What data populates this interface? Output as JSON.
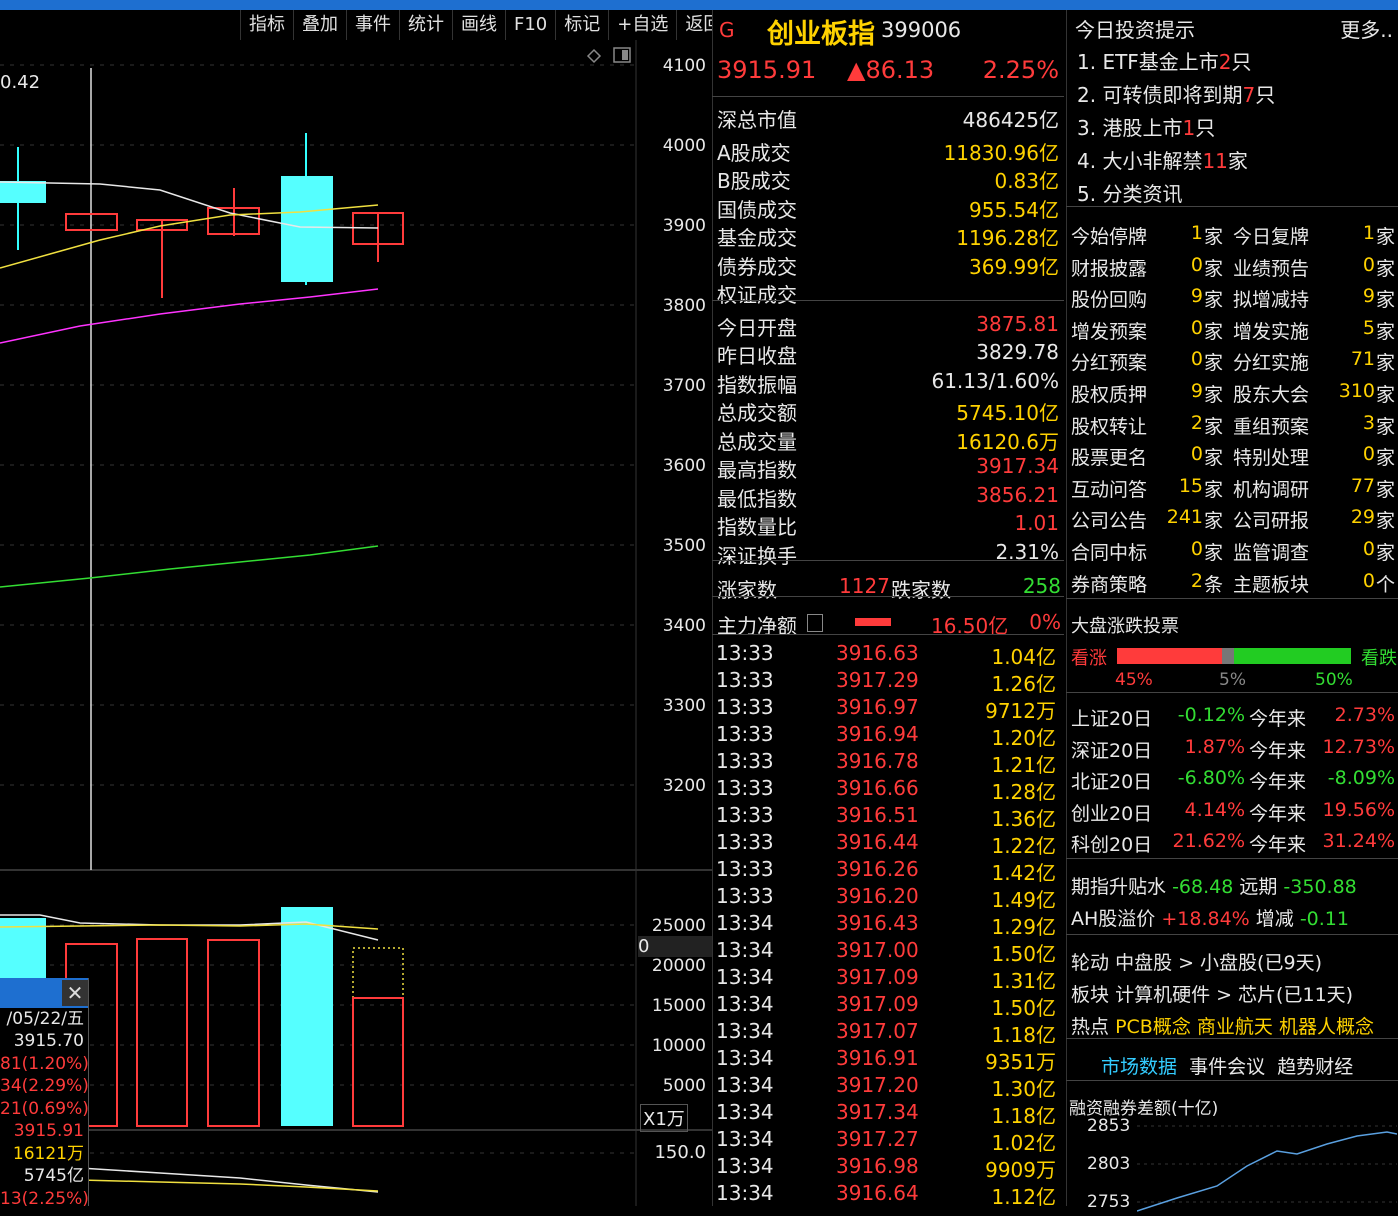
{
  "toolbar": [
    "指标",
    "叠加",
    "事件",
    "统计",
    "画线",
    "F10",
    "标记",
    "+自选",
    "返回"
  ],
  "chart": {
    "top_value": "0.42",
    "y_ticks": [
      "4100",
      "4000",
      "3900",
      "3800",
      "3700",
      "3600",
      "3500",
      "3400",
      "3300",
      "3200"
    ],
    "vol_ticks": [
      "25000",
      "20000",
      "15000",
      "10000",
      "5000"
    ],
    "vol_unit": "X1万",
    "vol_marker": "0",
    "macd_tick": "150.0"
  },
  "popup": {
    "date": "/05/22/五",
    "values": [
      "3915.70",
      "81(1.20%)",
      "34(2.29%)",
      "21(0.69%)",
      "3915.91",
      "16121万",
      "5745亿",
      "13(2.25%)"
    ]
  },
  "header": {
    "flag": "G",
    "name": "创业板指",
    "code": "399006",
    "price": "3915.91",
    "change": "▲86.13",
    "pct": "2.25%"
  },
  "stats": [
    {
      "k": "深总市值",
      "v": "486425亿",
      "c": "white"
    },
    {
      "k": "A股成交",
      "v": "11830.96亿",
      "c": "yellow"
    },
    {
      "k": "B股成交",
      "v": "0.83亿",
      "c": "yellow"
    },
    {
      "k": "国债成交",
      "v": "955.54亿",
      "c": "yellow"
    },
    {
      "k": "基金成交",
      "v": "1196.28亿",
      "c": "yellow"
    },
    {
      "k": "债券成交",
      "v": "369.99亿",
      "c": "yellow"
    },
    {
      "k": "权证成交",
      "v": "",
      "c": "yellow"
    },
    {
      "k": "今日开盘",
      "v": "3875.81",
      "c": "red"
    },
    {
      "k": "昨日收盘",
      "v": "3829.78",
      "c": "white"
    },
    {
      "k": "指数振幅",
      "v": "61.13/1.60%",
      "c": "white"
    },
    {
      "k": "总成交额",
      "v": "5745.10亿",
      "c": "yellow"
    },
    {
      "k": "总成交量",
      "v": "16120.6万",
      "c": "yellow"
    },
    {
      "k": "最高指数",
      "v": "3917.34",
      "c": "red"
    },
    {
      "k": "最低指数",
      "v": "3856.21",
      "c": "red"
    },
    {
      "k": "指数量比",
      "v": "1.01",
      "c": "red"
    },
    {
      "k": "深证换手",
      "v": "2.31%",
      "c": "white"
    }
  ],
  "updown": {
    "up_label": "涨家数",
    "up": "1127",
    "down_label": "跌家数",
    "down": "258"
  },
  "netflow": {
    "label": "主力净额",
    "value": "16.50亿",
    "pct": "0%"
  },
  "ticks": [
    [
      "13:33",
      "3916.63",
      "1.04亿"
    ],
    [
      "13:33",
      "3917.29",
      "1.26亿"
    ],
    [
      "13:33",
      "3916.97",
      "9712万"
    ],
    [
      "13:33",
      "3916.94",
      "1.20亿"
    ],
    [
      "13:33",
      "3916.78",
      "1.21亿"
    ],
    [
      "13:33",
      "3916.66",
      "1.28亿"
    ],
    [
      "13:33",
      "3916.51",
      "1.36亿"
    ],
    [
      "13:33",
      "3916.44",
      "1.22亿"
    ],
    [
      "13:33",
      "3916.26",
      "1.42亿"
    ],
    [
      "13:33",
      "3916.20",
      "1.49亿"
    ],
    [
      "13:34",
      "3916.43",
      "1.29亿"
    ],
    [
      "13:34",
      "3917.00",
      "1.50亿"
    ],
    [
      "13:34",
      "3917.09",
      "1.31亿"
    ],
    [
      "13:34",
      "3917.09",
      "1.50亿"
    ],
    [
      "13:34",
      "3917.07",
      "1.18亿"
    ],
    [
      "13:34",
      "3916.91",
      "9351万"
    ],
    [
      "13:34",
      "3917.20",
      "1.30亿"
    ],
    [
      "13:34",
      "3917.34",
      "1.18亿"
    ],
    [
      "13:34",
      "3917.27",
      "1.02亿"
    ],
    [
      "13:34",
      "3916.98",
      "9909万"
    ],
    [
      "13:34",
      "3916.64",
      "1.12亿"
    ]
  ],
  "tips": {
    "title": "今日投资提示",
    "more": "更多..",
    "items": [
      {
        "pre": "1. ETF基金上市",
        "num": "2",
        "post": "只"
      },
      {
        "pre": "2. 可转债即将到期",
        "num": "7",
        "post": "只"
      },
      {
        "pre": "3. 港股上市",
        "num": "1",
        "post": "只"
      },
      {
        "pre": "4. 大小非解禁",
        "num": "11",
        "post": "家"
      },
      {
        "pre": "5. 分类资讯",
        "num": "",
        "post": ""
      }
    ]
  },
  "events": [
    [
      "今始停牌",
      "1",
      "家",
      "今日复牌",
      "1",
      "家"
    ],
    [
      "财报披露",
      "0",
      "家",
      "业绩预告",
      "0",
      "家"
    ],
    [
      "股份回购",
      "9",
      "家",
      "拟增减持",
      "9",
      "家"
    ],
    [
      "增发预案",
      "0",
      "家",
      "增发实施",
      "5",
      "家"
    ],
    [
      "分红预案",
      "0",
      "家",
      "分红实施",
      "71",
      "家"
    ],
    [
      "股权质押",
      "9",
      "家",
      "股东大会",
      "310",
      "家"
    ],
    [
      "股权转让",
      "2",
      "家",
      "重组预案",
      "3",
      "家"
    ],
    [
      "股票更名",
      "0",
      "家",
      "特别处理",
      "0",
      "家"
    ],
    [
      "互动问答",
      "15",
      "家",
      "机构调研",
      "77",
      "家"
    ],
    [
      "公司公告",
      "241",
      "家",
      "公司研报",
      "29",
      "家"
    ],
    [
      "合同中标",
      "0",
      "家",
      "监管调查",
      "0",
      "家"
    ],
    [
      "券商策略",
      "2",
      "条",
      "主题板块",
      "0",
      "个"
    ]
  ],
  "vote": {
    "title": "大盘涨跌投票",
    "up_label": "看涨",
    "down_label": "看跌",
    "up": "45%",
    "mid": "5%",
    "down": "50%",
    "up_frac": 0.45,
    "mid_frac": 0.05,
    "down_frac": 0.5
  },
  "indices": [
    {
      "name": "上证20日",
      "v": "-0.12%",
      "vc": "green",
      "ytd_label": "今年来",
      "ytd": "2.73%",
      "yc": "red"
    },
    {
      "name": "深证20日",
      "v": "1.87%",
      "vc": "red",
      "ytd_label": "今年来",
      "ytd": "12.73%",
      "yc": "red"
    },
    {
      "name": "北证20日",
      "v": "-6.80%",
      "vc": "green",
      "ytd_label": "今年来",
      "ytd": "-8.09%",
      "yc": "green"
    },
    {
      "name": "创业20日",
      "v": "4.14%",
      "vc": "red",
      "ytd_label": "今年来",
      "ytd": "19.56%",
      "yc": "red"
    },
    {
      "name": "科创20日",
      "v": "21.62%",
      "vc": "red",
      "ytd_label": "今年来",
      "ytd": "31.24%",
      "yc": "red"
    }
  ],
  "futures": {
    "label": "期指升贴水",
    "near": "-68.48",
    "far_label": "远期",
    "far": "-350.88"
  },
  "ah": {
    "label": "AH股溢价",
    "value": "+18.84%",
    "chg_label": "增减",
    "chg": "-0.11"
  },
  "rotation": {
    "label": "轮动",
    "text": "中盘股 > 小盘股(已9天)"
  },
  "sector": {
    "label": "板块",
    "text": "计算机硬件 > 芯片(已11天)"
  },
  "hot": {
    "label": "热点",
    "items": [
      "PCB概念",
      "商业航天",
      "机器人概念"
    ]
  },
  "tabs": [
    "市场数据",
    "事件会议",
    "趋势财经"
  ],
  "margin": {
    "title": "融资融券差额(十亿)",
    "ticks": [
      "2853",
      "2803",
      "2753"
    ]
  }
}
